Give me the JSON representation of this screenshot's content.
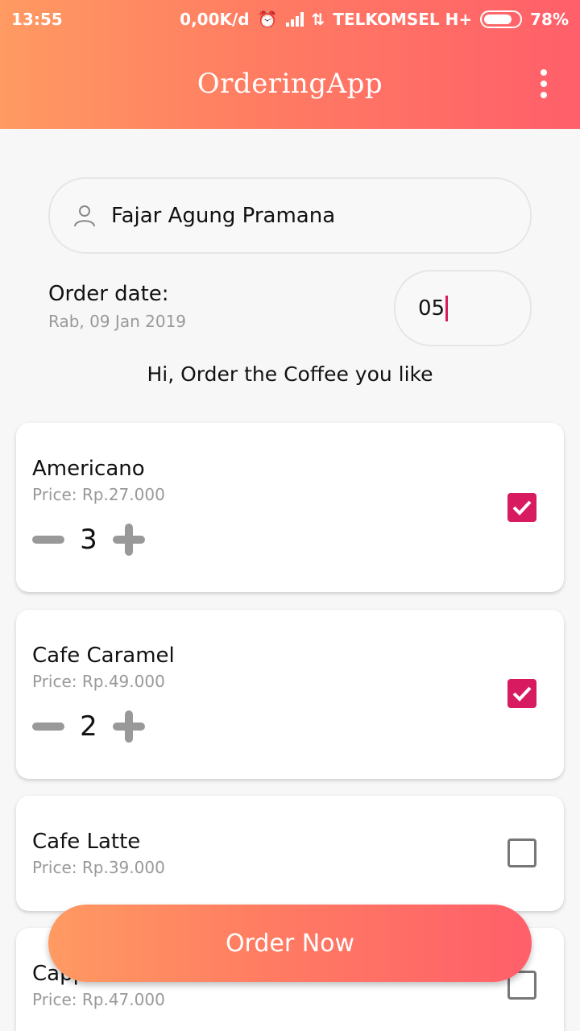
{
  "status_bar": {
    "time": "13:55",
    "network_speed": "0,00K/d",
    "carrier": "TELKOMSEL H+",
    "battery": "78%"
  },
  "app_bar": {
    "title": "OrderingApp"
  },
  "customer": {
    "name": "Fajar Agung Pramana"
  },
  "order_date": {
    "label": "Order date:",
    "value": "Rab, 09 Jan 2019",
    "input_value": "05"
  },
  "greeting": "Hi, Order the Coffee you like",
  "menu": [
    {
      "name": "Americano",
      "price": "Price: Rp.27.000",
      "quantity": "3",
      "checked": true
    },
    {
      "name": "Cafe Caramel",
      "price": "Price: Rp.49.000",
      "quantity": "2",
      "checked": true
    },
    {
      "name": "Cafe Latte",
      "price": "Price: Rp.39.000",
      "checked": false
    },
    {
      "name": "Cappuccino",
      "price": "Price: Rp.47.000",
      "checked": false
    }
  ],
  "order_button": {
    "label": "Order Now"
  },
  "colors": {
    "accent": "#d81b60",
    "gradient_start": "#ff9a62",
    "gradient_end": "#ff5f6a"
  }
}
